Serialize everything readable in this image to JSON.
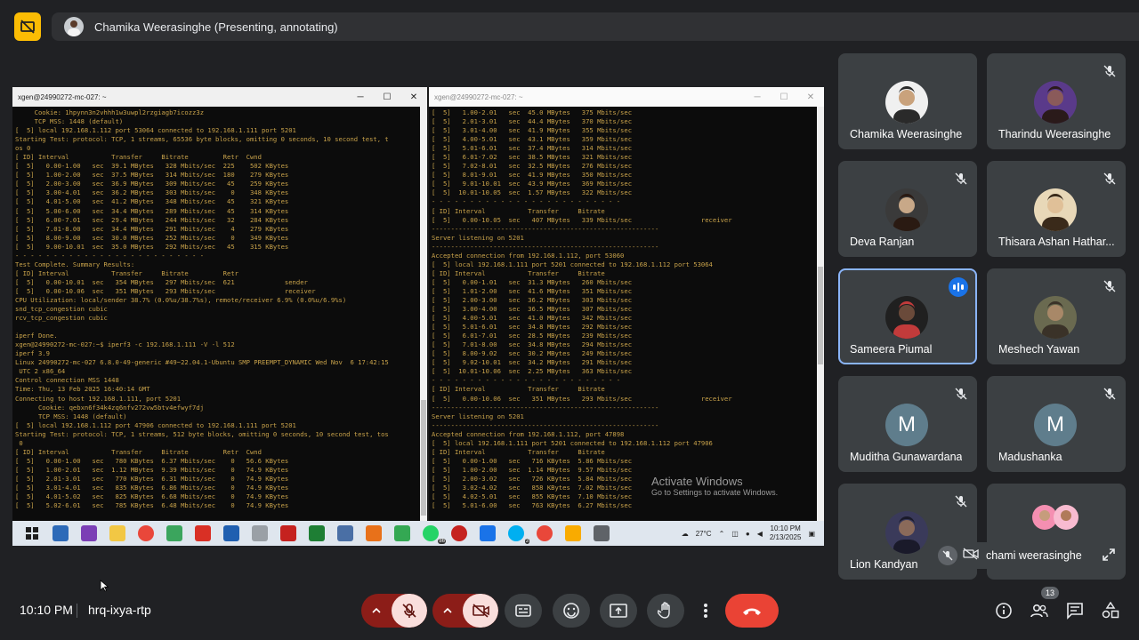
{
  "presenter": {
    "label": "Chamika Weerasinghe (Presenting, annotating)"
  },
  "terminal_left": {
    "title": "xgen@24990272-mc-027: ~",
    "lines": [
      "     Cookie: 1hpynn3n2vhhh1w3uwpl2rzgiagb7icozz3z",
      "     TCP MSS: 1448 (default)",
      "[  5] local 192.168.1.112 port 53064 connected to 192.168.1.111 port 5201",
      "Starting Test: protocol: TCP, 1 streams, 65536 byte blocks, omitting 0 seconds, 10 second test, t",
      "os 0",
      "[ ID] Interval           Transfer     Bitrate         Retr  Cwnd",
      "[  5]   0.00-1.00   sec  39.1 MBytes   328 Mbits/sec  225    502 KBytes",
      "[  5]   1.00-2.00   sec  37.5 MBytes   314 Mbits/sec  180    279 KBytes",
      "[  5]   2.00-3.00   sec  36.9 MBytes   309 Mbits/sec   45    259 KBytes",
      "[  5]   3.00-4.01   sec  36.2 MBytes   303 Mbits/sec    0    348 KBytes",
      "[  5]   4.01-5.00   sec  41.2 MBytes   348 Mbits/sec   45    321 KBytes",
      "[  5]   5.00-6.00   sec  34.4 MBytes   289 Mbits/sec   45    314 KBytes",
      "[  5]   6.00-7.01   sec  29.4 MBytes   244 Mbits/sec   32    284 KBytes",
      "[  5]   7.01-8.00   sec  34.4 MBytes   291 Mbits/sec    4    279 KBytes",
      "[  5]   8.00-9.00   sec  30.0 MBytes   252 Mbits/sec    0    349 KBytes",
      "[  5]   9.00-10.01  sec  35.0 MBytes   292 Mbits/sec   45    315 KBytes",
      "- - - - - - - - - - - - - - - - - - - - - - - - -",
      "Test Complete. Summary Results:",
      "[ ID] Interval           Transfer     Bitrate         Retr",
      "[  5]   0.00-10.01  sec   354 MBytes   297 Mbits/sec  621             sender",
      "[  5]   0.00-10.06  sec   351 MBytes   293 Mbits/sec                  receiver",
      "CPU Utilization: local/sender 38.7% (0.0%u/38.7%s), remote/receiver 6.9% (0.0%u/6.9%s)",
      "snd_tcp_congestion cubic",
      "rcv_tcp_congestion cubic",
      "",
      "iperf Done.",
      "xgen@24990272-mc-027:~$ iperf3 -c 192.168.1.111 -V -l 512",
      "iperf 3.9",
      "Linux 24990272-mc-027 6.8.0-49-generic #49~22.04.1-Ubuntu SMP PREEMPT_DYNAMIC Wed Nov  6 17:42:15",
      " UTC 2 x86_64",
      "Control connection MSS 1448",
      "Time: Thu, 13 Feb 2025 16:40:14 GMT",
      "Connecting to host 192.168.1.111, port 5201",
      "      Cookie: qebxn6f34k4zq6nfv272vw5btv4efwyf7dj",
      "      TCP MSS: 1448 (default)",
      "[  5] local 192.168.1.112 port 47906 connected to 192.168.1.111 port 5201",
      "Starting Test: protocol: TCP, 1 streams, 512 byte blocks, omitting 0 seconds, 10 second test, tos",
      " 0",
      "[ ID] Interval           Transfer     Bitrate         Retr  Cwnd",
      "[  5]   0.00-1.00   sec   780 KBytes  6.37 Mbits/sec    0   56.6 KBytes",
      "[  5]   1.00-2.01   sec  1.12 MBytes  9.39 Mbits/sec    0   74.9 KBytes",
      "[  5]   2.01-3.01   sec   770 KBytes  6.31 Mbits/sec    0   74.9 KBytes",
      "[  5]   3.01-4.01   sec   835 KBytes  6.86 Mbits/sec    0   74.9 KBytes",
      "[  5]   4.01-5.02   sec   825 KBytes  6.68 Mbits/sec    0   74.9 KBytes",
      "[  5]   5.02-6.01   sec   785 KBytes  6.48 Mbits/sec    0   74.9 KBytes"
    ]
  },
  "terminal_right": {
    "title": "xgen@24990272-mc-027: ~",
    "lines": [
      "[  5]   1.00-2.01   sec  45.0 MBytes   375 Mbits/sec",
      "[  5]   2.01-3.01   sec  44.4 MBytes   370 Mbits/sec",
      "[  5]   3.01-4.00   sec  41.9 MBytes   355 Mbits/sec",
      "[  5]   4.00-5.01   sec  43.1 MBytes   359 Mbits/sec",
      "[  5]   5.01-6.01   sec  37.4 MBytes   314 Mbits/sec",
      "[  5]   6.01-7.02   sec  38.5 MBytes   321 Mbits/sec",
      "[  5]   7.02-8.01   sec  32.5 MBytes   276 Mbits/sec",
      "[  5]   8.01-9.01   sec  41.9 MBytes   350 Mbits/sec",
      "[  5]   9.01-10.01  sec  43.9 MBytes   369 Mbits/sec",
      "[  5]  10.01-10.05  sec  1.57 MBytes   322 Mbits/sec",
      "- - - - - - - - - - - - - - - - - - - - - - - - -",
      "[ ID] Interval           Transfer     Bitrate",
      "[  5]   0.00-10.05  sec   407 MBytes   339 Mbits/sec                  receiver",
      "-----------------------------------------------------------",
      "Server listening on 5201",
      "-----------------------------------------------------------",
      "Accepted connection from 192.168.1.112, port 53060",
      "[  5] local 192.168.1.111 port 5201 connected to 192.168.1.112 port 53064",
      "[ ID] Interval           Transfer     Bitrate",
      "[  5]   0.00-1.01   sec  31.3 MBytes   260 Mbits/sec",
      "[  5]   1.01-2.00   sec  41.6 MBytes   351 Mbits/sec",
      "[  5]   2.00-3.00   sec  36.2 MBytes   303 Mbits/sec",
      "[  5]   3.00-4.00   sec  36.5 MBytes   307 Mbits/sec",
      "[  5]   4.00-5.01   sec  41.0 MBytes   342 Mbits/sec",
      "[  5]   5.01-6.01   sec  34.8 MBytes   292 Mbits/sec",
      "[  5]   6.01-7.01   sec  28.5 MBytes   239 Mbits/sec",
      "[  5]   7.01-8.00   sec  34.8 MBytes   294 Mbits/sec",
      "[  5]   8.00-9.02   sec  30.2 MBytes   249 Mbits/sec",
      "[  5]   9.02-10.01  sec  34.2 MBytes   291 Mbits/sec",
      "[  5]  10.01-10.06  sec  2.25 MBytes   363 Mbits/sec",
      "- - - - - - - - - - - - - - - - - - - - - - - - -",
      "[ ID] Interval           Transfer     Bitrate",
      "[  5]   0.00-10.06  sec   351 MBytes   293 Mbits/sec                  receiver",
      "-----------------------------------------------------------",
      "Server listening on 5201",
      "-----------------------------------------------------------",
      "Accepted connection from 192.168.1.112, port 47898",
      "[  5] local 192.168.1.111 port 5201 connected to 192.168.1.112 port 47906",
      "[ ID] Interval           Transfer     Bitrate",
      "[  5]   0.00-1.00   sec   716 KBytes  5.86 Mbits/sec",
      "[  5]   1.00-2.00   sec  1.14 MBytes  9.57 Mbits/sec",
      "[  5]   2.00-3.02   sec   726 KBytes  5.84 Mbits/sec",
      "[  5]   3.02-4.02   sec   858 KBytes  7.02 Mbits/sec",
      "[  5]   4.02-5.01   sec   855 KBytes  7.10 Mbits/sec",
      "[  5]   5.01-6.00   sec   763 KBytes  6.27 Mbits/sec"
    ]
  },
  "activate_windows": {
    "line1": "Activate Windows",
    "line2": "Go to Settings to activate Windows."
  },
  "taskbar": {
    "weather": "27°C",
    "time": "10:10 PM",
    "date": "2/13/2025",
    "whatsapp_badge": "86",
    "skype_badge": "3"
  },
  "participants": [
    {
      "name": "Chamika Weerasinghe",
      "muted": false,
      "avatar": "photo"
    },
    {
      "name": "Tharindu Weerasinghe",
      "muted": true,
      "avatar": "photo"
    },
    {
      "name": "Deva Ranjan",
      "muted": true,
      "avatar": "photo"
    },
    {
      "name": "Thisara Ashan Hathar...",
      "muted": true,
      "avatar": "photo"
    },
    {
      "name": "Sameera Piumal",
      "muted": false,
      "speaking": true,
      "avatar": "photo"
    },
    {
      "name": "Meshech Yawan",
      "muted": true,
      "avatar": "photo"
    },
    {
      "name": "Muditha Gunawardana",
      "muted": true,
      "avatar": "letter",
      "letter": "M"
    },
    {
      "name": "Madushanka",
      "muted": true,
      "avatar": "letter",
      "letter": "M"
    },
    {
      "name": "Lion Kandyan",
      "muted": true,
      "avatar": "photo"
    }
  ],
  "self_view": {
    "name": "chami weerasinghe"
  },
  "meeting": {
    "time": "10:10 PM",
    "code": "hrq-ixya-rtp",
    "participant_count": "13"
  },
  "colors": {
    "accent": "#8ab4f8",
    "end_call": "#ea4335",
    "muted_ctl": "#f9dedc",
    "present": "#fbbc04",
    "speaking": "#1a73e8"
  }
}
